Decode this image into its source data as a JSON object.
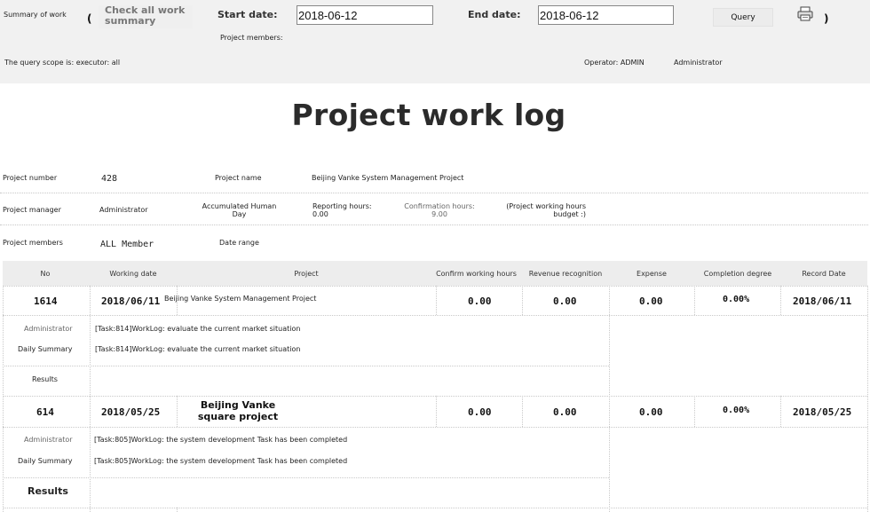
{
  "toolbar": {
    "summary_of_work": "Summary of work",
    "open_paren": "(",
    "close_paren": ")",
    "check_all_label": "Check all work summary",
    "start_date_label": "Start date:",
    "start_date_value": "2018-06-12",
    "end_date_label": "End date:",
    "end_date_value": "2018-06-12",
    "query_label": "Query",
    "project_members_label": "Project members:",
    "query_scope": "The query scope is: executor: all",
    "operator": "Operator: ADMIN",
    "operator_name": "Administrator"
  },
  "report": {
    "title": "Project work log",
    "project_number_label": "Project number",
    "project_number": "428",
    "project_name_label": "Project name",
    "project_name": "Beijing Vanke System Management Project",
    "project_manager_label": "Project manager",
    "project_manager": "Administrator",
    "accumulated_label": "Accumulated Human Day",
    "reporting_hours": "Reporting hours: 0.00",
    "confirmation_hours": "Confirmation hours: 9.00",
    "working_hours_budget": "(Project working hours budget :)",
    "project_members_label": "Project members",
    "project_members": "ALL Member",
    "date_range_label": "Date range"
  },
  "table": {
    "headers": [
      "No",
      "Working date",
      "Project",
      "Confirm working hours",
      "Revenue recognition",
      "Expense",
      "Completion degree",
      "Record Date"
    ],
    "records": [
      {
        "no": "1614",
        "working_date": "2018/06/11",
        "project": "Beijing Vanke System Management Project",
        "confirm_hours": "0.00",
        "revenue": "0.00",
        "expense": "0.00",
        "completion": "0.00%",
        "record_date": "2018/06/11",
        "executor": "Administrator",
        "executor_log": "[Task:814]WorkLog: evaluate the current market situation",
        "daily_summary_label": "Daily Summary",
        "daily_summary": "[Task:814]WorkLog: evaluate the current market situation",
        "results_label": "Results"
      },
      {
        "no": "614",
        "working_date": "2018/05/25",
        "project": "Beijing Vanke square project",
        "confirm_hours": "0.00",
        "revenue": "0.00",
        "expense": "0.00",
        "completion": "0.00%",
        "record_date": "2018/05/25",
        "executor": "Administrator",
        "executor_log": "[Task:805]WorkLog: the system development Task has been completed",
        "daily_summary_label": "Daily Summary",
        "daily_summary": "[Task:805]WorkLog: the system development Task has been completed",
        "results_label": "Results"
      }
    ]
  },
  "icons": {
    "print": "printer-icon"
  },
  "colors": {
    "toolbar_bg": "#f1f1f1",
    "header_bg": "#ededed"
  }
}
